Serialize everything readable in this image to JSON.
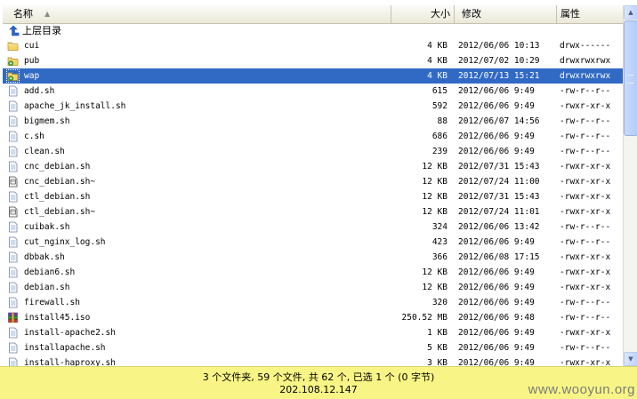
{
  "header": {
    "name": "名称",
    "size": "大小",
    "modified": "修改",
    "attrs": "属性"
  },
  "up_label": "上层目录",
  "files": [
    {
      "name": "cui",
      "size": "4 KB",
      "date": "2012/06/06 10:13",
      "attr": "drwx------",
      "icon": "folder-icon"
    },
    {
      "name": "pub",
      "size": "4 KB",
      "date": "2012/07/02 10:29",
      "attr": "drwxrwxrwx",
      "icon": "shared-folder-icon"
    },
    {
      "name": "wap",
      "size": "4 KB",
      "date": "2012/07/13 15:21",
      "attr": "drwxrwxrwx",
      "icon": "shared-folder-icon",
      "selected": true
    },
    {
      "name": "add.sh",
      "size": "615",
      "date": "2012/06/06 9:49",
      "attr": "-rw-r--r--",
      "icon": "file-icon"
    },
    {
      "name": "apache_jk_install.sh",
      "size": "592",
      "date": "2012/06/06 9:49",
      "attr": "-rwxr-xr-x",
      "icon": "file-icon"
    },
    {
      "name": "bigmem.sh",
      "size": "88",
      "date": "2012/06/07 14:56",
      "attr": "-rw-r--r--",
      "icon": "file-icon"
    },
    {
      "name": "c.sh",
      "size": "686",
      "date": "2012/06/06 9:49",
      "attr": "-rw-r--r--",
      "icon": "file-icon"
    },
    {
      "name": "clean.sh",
      "size": "239",
      "date": "2012/06/06 9:49",
      "attr": "-rw-r--r--",
      "icon": "file-icon"
    },
    {
      "name": "cnc_debian.sh",
      "size": "12 KB",
      "date": "2012/07/31 15:43",
      "attr": "-rwxr-xr-x",
      "icon": "file-icon"
    },
    {
      "name": "cnc_debian.sh~",
      "size": "12 KB",
      "date": "2012/07/24 11:00",
      "attr": "-rwxr-xr-x",
      "icon": "backup-file-icon"
    },
    {
      "name": "ctl_debian.sh",
      "size": "12 KB",
      "date": "2012/07/31 15:43",
      "attr": "-rwxr-xr-x",
      "icon": "file-icon"
    },
    {
      "name": "ctl_debian.sh~",
      "size": "12 KB",
      "date": "2012/07/24 11:01",
      "attr": "-rwxr-xr-x",
      "icon": "backup-file-icon"
    },
    {
      "name": "cuibak.sh",
      "size": "324",
      "date": "2012/06/06 13:42",
      "attr": "-rw-r--r--",
      "icon": "file-icon"
    },
    {
      "name": "cut_nginx_log.sh",
      "size": "423",
      "date": "2012/06/06 9:49",
      "attr": "-rw-r--r--",
      "icon": "file-icon"
    },
    {
      "name": "dbbak.sh",
      "size": "366",
      "date": "2012/06/08 17:15",
      "attr": "-rwxr-xr-x",
      "icon": "file-icon"
    },
    {
      "name": "debian6.sh",
      "size": "12 KB",
      "date": "2012/06/06 9:49",
      "attr": "-rwxr-xr-x",
      "icon": "file-icon"
    },
    {
      "name": "debian.sh",
      "size": "12 KB",
      "date": "2012/06/06 9:49",
      "attr": "-rwxr-xr-x",
      "icon": "file-icon"
    },
    {
      "name": "firewall.sh",
      "size": "320",
      "date": "2012/06/06 9:49",
      "attr": "-rw-r--r--",
      "icon": "file-icon"
    },
    {
      "name": "install45.iso",
      "size": "250.52 MB",
      "date": "2012/06/06 9:48",
      "attr": "-rw-r--r--",
      "icon": "archive-icon"
    },
    {
      "name": "install-apache2.sh",
      "size": "1 KB",
      "date": "2012/06/06 9:49",
      "attr": "-rwxr-xr-x",
      "icon": "file-icon"
    },
    {
      "name": "installapache.sh",
      "size": "5 KB",
      "date": "2012/06/06 9:49",
      "attr": "-rw-r--r--",
      "icon": "file-icon"
    },
    {
      "name": "install-haproxy.sh",
      "size": "3 KB",
      "date": "2012/06/06 9:49",
      "attr": "-rwxr-xr-x",
      "icon": "file-icon"
    }
  ],
  "status": {
    "summary": "3 个文件夹, 59 个文件, 共 62 个, 已选 1 个 (0 字节)",
    "host": "202.108.12.147"
  },
  "watermark": "www.wooyun.org",
  "colors": {
    "selection": "#316ac5",
    "status_bg": "#f8f586"
  }
}
